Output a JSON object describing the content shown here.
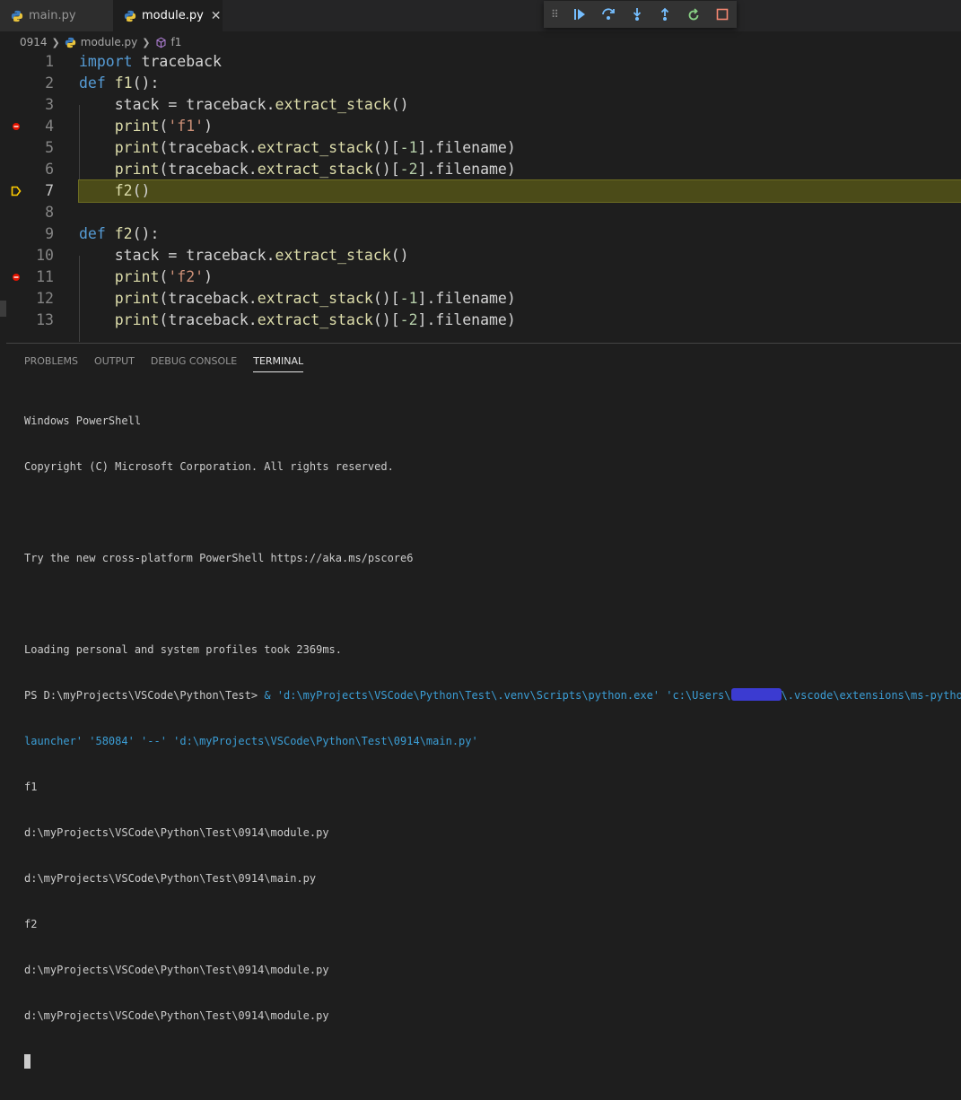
{
  "tabs": [
    {
      "label": "main.py",
      "active": false
    },
    {
      "label": "module.py",
      "active": true
    }
  ],
  "breadcrumb": {
    "folder": "0914",
    "file": "module.py",
    "symbol": "f1"
  },
  "debug_toolbar": {
    "buttons": [
      "continue-icon",
      "step-over-icon",
      "step-into-icon",
      "step-out-icon",
      "restart-icon",
      "stop-icon"
    ],
    "colors": {
      "continue": "#75beff",
      "restart": "#89d185",
      "stop": "#f48771"
    }
  },
  "editor": {
    "current_line": 7,
    "breakpoints": [
      4,
      11
    ],
    "lines": [
      {
        "num": "1",
        "text": "import traceback"
      },
      {
        "num": "2",
        "text": "def f1():"
      },
      {
        "num": "3",
        "text": "    stack = traceback.extract_stack()"
      },
      {
        "num": "4",
        "text": "    print('f1')"
      },
      {
        "num": "5",
        "text": "    print(traceback.extract_stack()[-1].filename)"
      },
      {
        "num": "6",
        "text": "    print(traceback.extract_stack()[-2].filename)"
      },
      {
        "num": "7",
        "text": "    f2()"
      },
      {
        "num": "8",
        "text": ""
      },
      {
        "num": "9",
        "text": "def f2():"
      },
      {
        "num": "10",
        "text": "    stack = traceback.extract_stack()"
      },
      {
        "num": "11",
        "text": "    print('f2')"
      },
      {
        "num": "12",
        "text": "    print(traceback.extract_stack()[-1].filename)"
      },
      {
        "num": "13",
        "text": "    print(traceback.extract_stack()[-2].filename)"
      }
    ]
  },
  "panel": {
    "tabs": [
      "PROBLEMS",
      "OUTPUT",
      "DEBUG CONSOLE",
      "TERMINAL"
    ],
    "active_tab": "TERMINAL"
  },
  "terminal": {
    "lines": [
      "Windows PowerShell",
      "Copyright (C) Microsoft Corporation. All rights reserved.",
      "",
      "Try the new cross-platform PowerShell https://aka.ms/pscore6",
      "",
      "Loading personal and system profiles took 2369ms."
    ],
    "prompt": "PS D:\\myProjects\\VSCode\\Python\\Test>",
    "command_part1": " & 'd:\\myProjects\\VSCode\\Python\\Test\\.venv\\Scripts\\python.exe' 'c:\\Users\\",
    "command_part2": "\\.vscode\\extensions\\ms-python.pyt",
    "command_line2": "launcher' '58084' '--' 'd:\\myProjects\\VSCode\\Python\\Test\\0914\\main.py'",
    "output": [
      "f1",
      "d:\\myProjects\\VSCode\\Python\\Test\\0914\\module.py",
      "d:\\myProjects\\VSCode\\Python\\Test\\0914\\main.py",
      "f2",
      "d:\\myProjects\\VSCode\\Python\\Test\\0914\\module.py",
      "d:\\myProjects\\VSCode\\Python\\Test\\0914\\module.py"
    ]
  }
}
